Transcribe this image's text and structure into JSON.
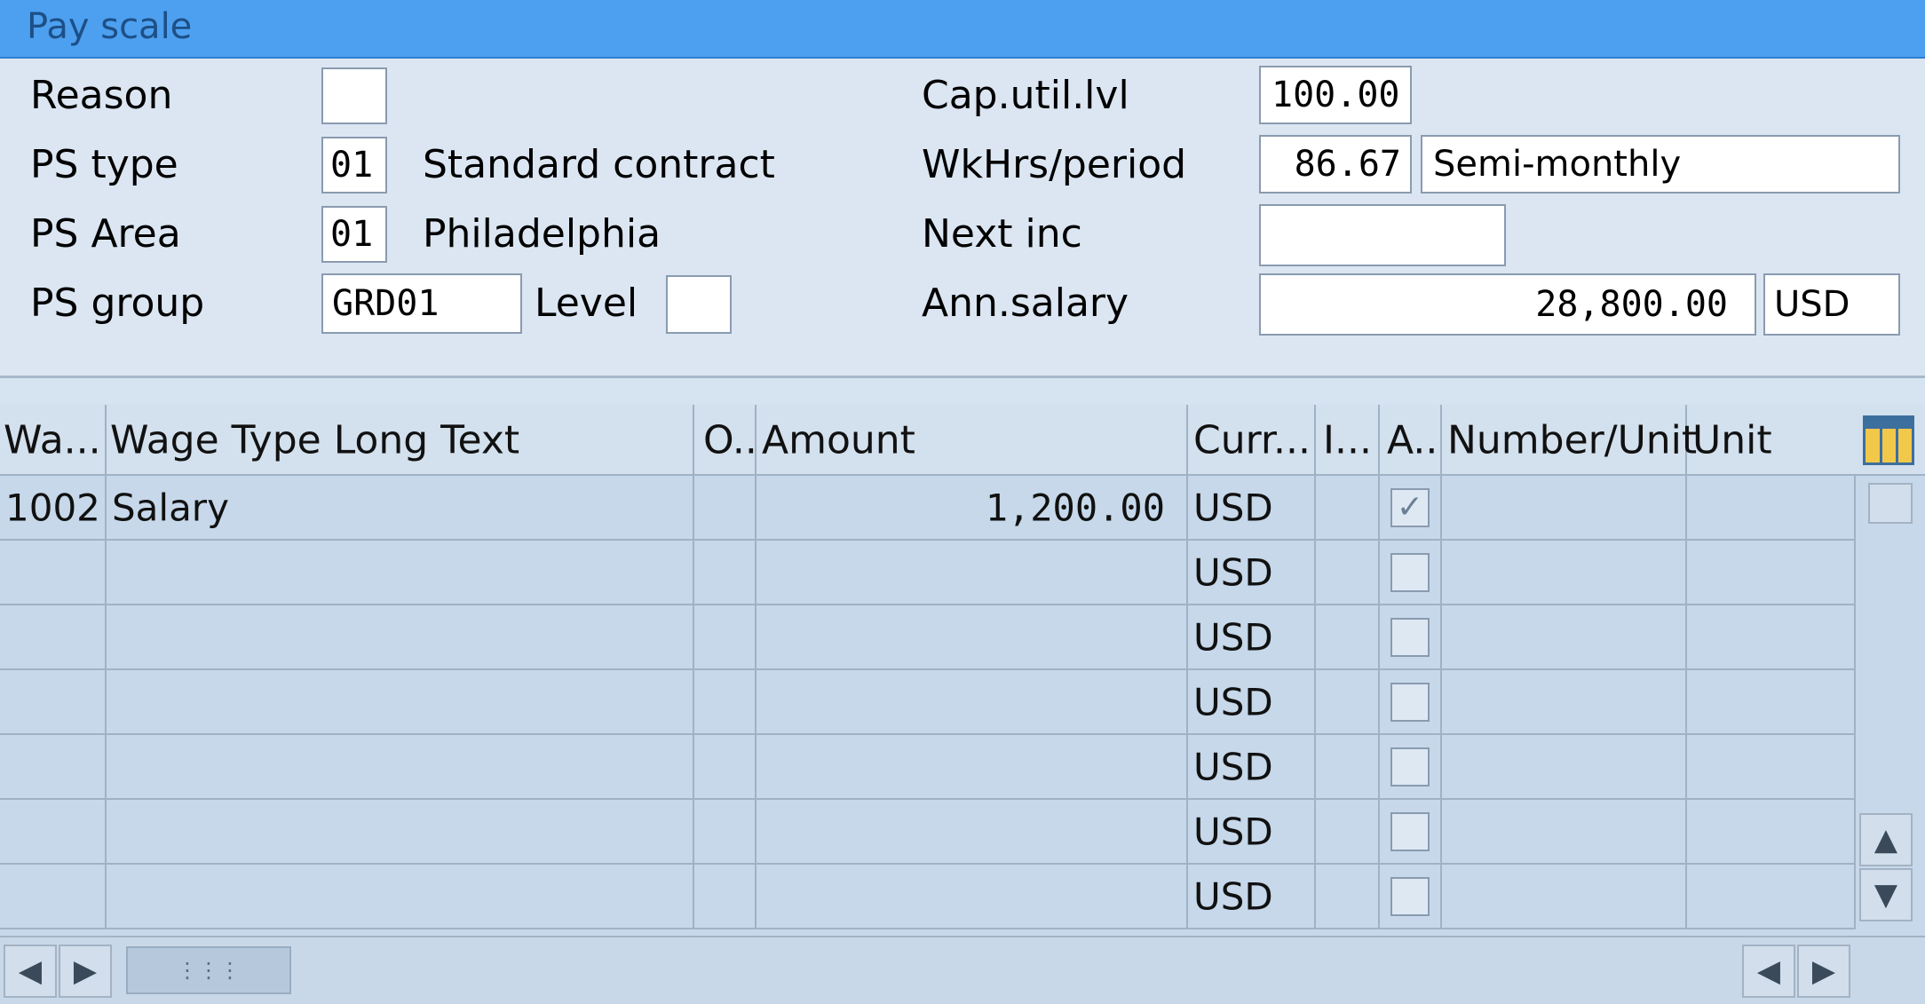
{
  "panel": {
    "title": "Pay scale"
  },
  "form": {
    "reason_label": "Reason",
    "reason_value": "",
    "ps_type_label": "PS type",
    "ps_type_value": "01",
    "ps_type_text": "Standard contract",
    "ps_area_label": "PS Area",
    "ps_area_value": "01",
    "ps_area_text": "Philadelphia",
    "ps_group_label": "PS group",
    "ps_group_value": "GRD01",
    "level_label": "Level",
    "level_value": "",
    "cap_util_label": "Cap.util.lvl",
    "cap_util_value": "100.00",
    "wkhrs_label": "WkHrs/period",
    "wkhrs_value": "86.67",
    "wkhrs_period": "Semi-monthly",
    "next_inc_label": "Next inc",
    "next_inc_value": "",
    "ann_salary_label": "Ann.salary",
    "ann_salary_value": "28,800.00",
    "ann_salary_currency": "USD"
  },
  "table": {
    "headers": {
      "wage_type": "Wa...",
      "long_text": "Wage Type Long Text",
      "o": "O..",
      "amount": "Amount",
      "curr": "Curr...",
      "i": "I...",
      "a": "A..",
      "number_unit": "Number/Unit",
      "unit": "Unit"
    },
    "rows": [
      {
        "wage_type": "1002",
        "long_text": "Salary",
        "amount": "1,200.00",
        "curr": "USD",
        "checked": true
      },
      {
        "wage_type": "",
        "long_text": "",
        "amount": "",
        "curr": "USD",
        "checked": false
      },
      {
        "wage_type": "",
        "long_text": "",
        "amount": "",
        "curr": "USD",
        "checked": false
      },
      {
        "wage_type": "",
        "long_text": "",
        "amount": "",
        "curr": "USD",
        "checked": false
      },
      {
        "wage_type": "",
        "long_text": "",
        "amount": "",
        "curr": "USD",
        "checked": false
      },
      {
        "wage_type": "",
        "long_text": "",
        "amount": "",
        "curr": "USD",
        "checked": false
      },
      {
        "wage_type": "",
        "long_text": "",
        "amount": "",
        "curr": "USD",
        "checked": false
      }
    ],
    "check_mark": "✓"
  },
  "icons": {
    "scroll_up": "▲",
    "scroll_down": "▼",
    "scroll_left": "◀",
    "scroll_right": "▶",
    "grip": "⋮⋮⋮"
  },
  "colors": {
    "header_bar": "#4da0f0",
    "panel_bg": "#d6e3f0",
    "table_bg": "#c6d8ea"
  }
}
